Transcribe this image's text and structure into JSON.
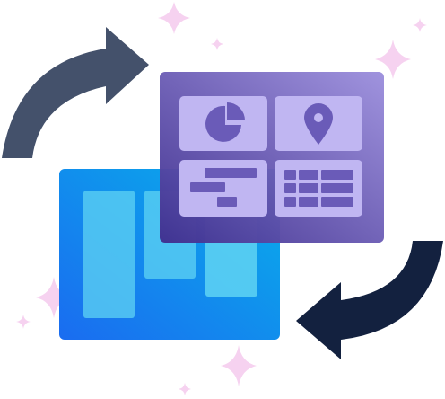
{
  "illustration": {
    "subject": "dashboard-conversion",
    "colors": {
      "arrow_top": "#44516b",
      "arrow_bottom": "#13213f",
      "purple_panel_light": "#9d90dd",
      "purple_panel_dark": "#3f2f8f",
      "purple_tile": "#c0b6f2",
      "purple_glyph": "#6a5bb8",
      "blue_panel_light": "#08b0ea",
      "blue_panel_dark": "#1a6cf0",
      "blue_bar": "#5fd3f3",
      "sparkle": "#f6d2f0"
    }
  }
}
